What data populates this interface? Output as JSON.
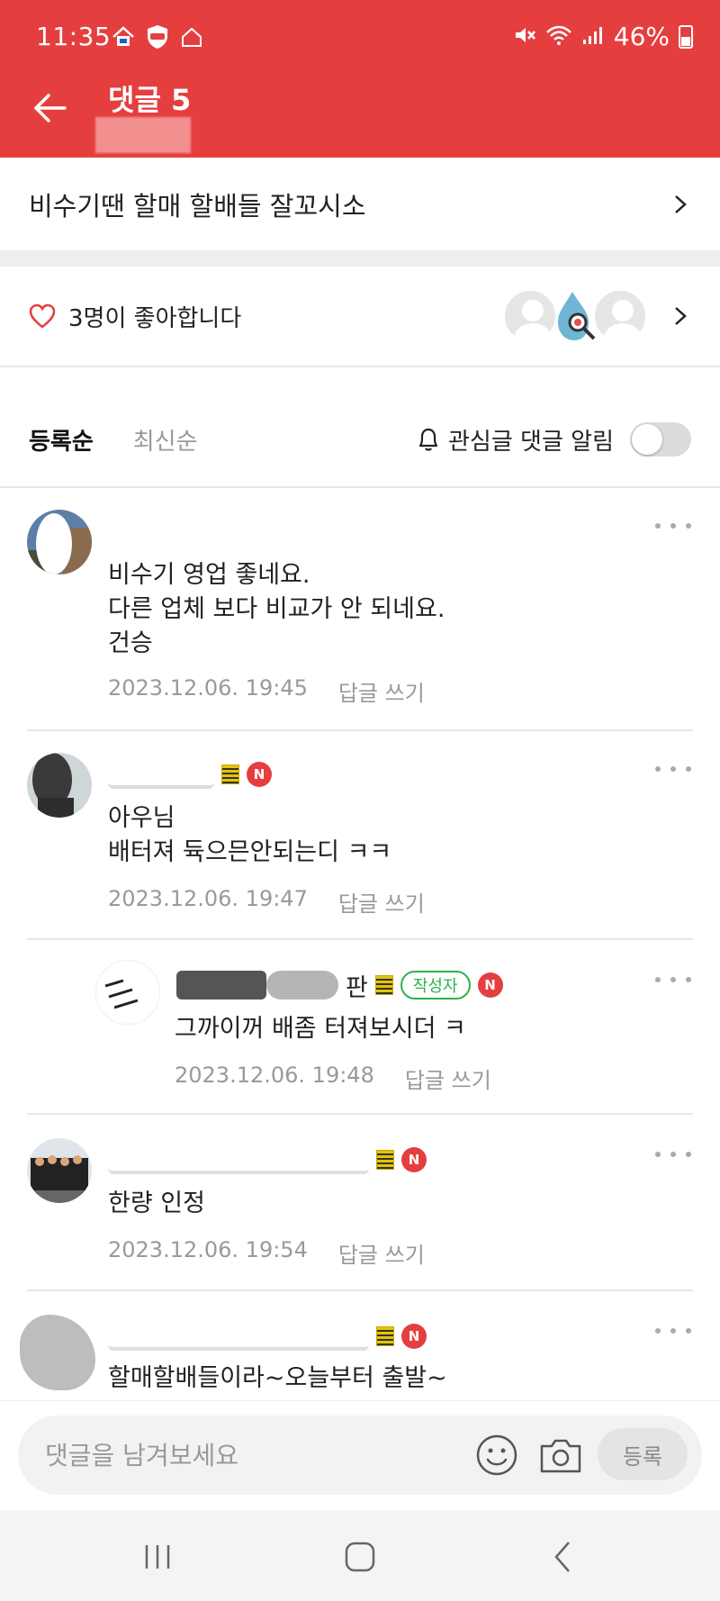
{
  "status_bar": {
    "time": "11:35",
    "battery": "46%"
  },
  "header": {
    "title": "댓글 5"
  },
  "post": {
    "title": "비수기땐 할매 할배들 잘꼬시소"
  },
  "likes": {
    "text": "3명이 좋아합니다"
  },
  "sort": {
    "tab_registered": "등록순",
    "tab_latest": "최신순",
    "notify_label": "관심글 댓글 알림"
  },
  "comments": [
    {
      "text": "비수기 영업 좋네요.\n다른 업체 보다 비교가 안 되네요.\n건승",
      "date": "2023.12.06. 19:45",
      "reply": "답글 쓰기"
    },
    {
      "text": "아우님\n배터져 듁으믄안되는디 ㅋㅋ",
      "date": "2023.12.06. 19:47",
      "reply": "답글 쓰기",
      "badge": "N"
    },
    {
      "name_suffix": "판",
      "author_badge": "작성자",
      "text": "그까이꺼 배좀 터져보시더 ㅋ",
      "date": "2023.12.06. 19:48",
      "reply": "답글 쓰기",
      "badge": "N"
    },
    {
      "text": "한량 인정",
      "date": "2023.12.06. 19:54",
      "reply": "답글 쓰기",
      "badge": "N"
    },
    {
      "text": "할매할배들이라~오늘부터 출발~",
      "badge": "N"
    }
  ],
  "input": {
    "placeholder": "댓글을 남겨보세요",
    "submit_label": "등록"
  },
  "colors": {
    "accent": "#e53e3e",
    "author_green": "#2bb24c"
  }
}
